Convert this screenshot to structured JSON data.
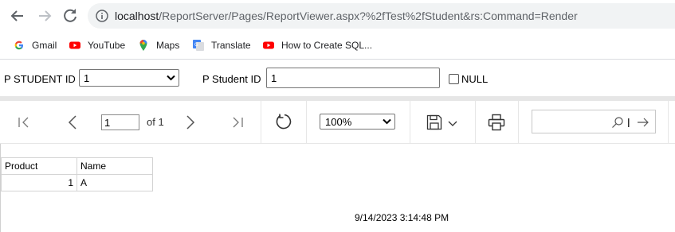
{
  "browser": {
    "url_host": "localhost",
    "url_path": "/ReportServer/Pages/ReportViewer.aspx?%2fTest%2fStudent&rs:Command=Render",
    "bookmarks": [
      {
        "label": "Gmail",
        "icon": "gmail-icon"
      },
      {
        "label": "YouTube",
        "icon": "youtube-icon"
      },
      {
        "label": "Maps",
        "icon": "maps-icon"
      },
      {
        "label": "Translate",
        "icon": "translate-icon"
      },
      {
        "label": "How to Create SQL...",
        "icon": "youtube-icon"
      }
    ]
  },
  "parameters": {
    "p1_label": "P STUDENT ID",
    "p1_value": "1",
    "p2_label": "P Student ID",
    "p2_value": "1",
    "null_label": "NULL"
  },
  "toolbar": {
    "current_page": "1",
    "of_pages": "of 1",
    "zoom": "100%"
  },
  "report": {
    "headers": [
      "Product",
      "Name"
    ],
    "rows": [
      [
        "1",
        "A"
      ]
    ],
    "timestamp": "9/14/2023 3:14:48 PM"
  }
}
